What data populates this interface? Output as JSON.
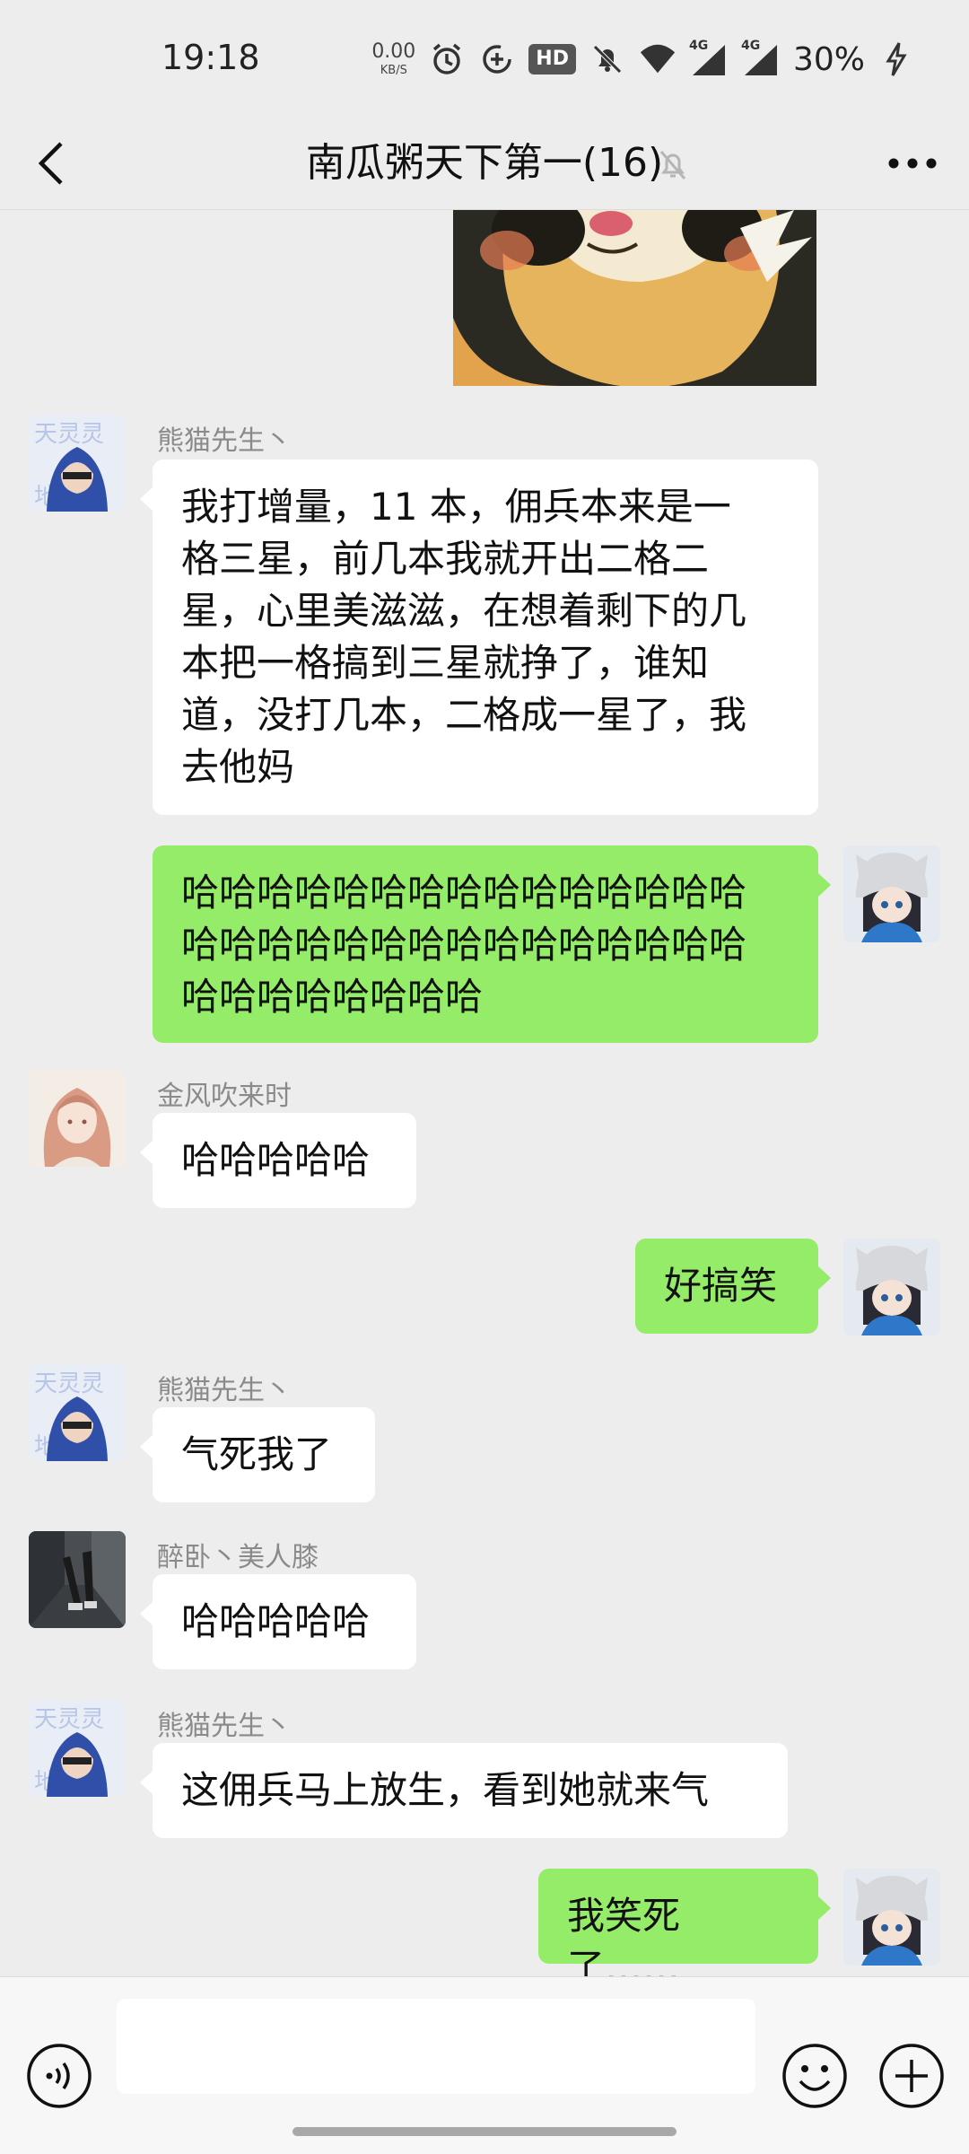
{
  "status_bar": {
    "time": "19:18",
    "net_speed_value": "0.00",
    "net_speed_unit": "KB/S",
    "hd_label": "HD",
    "signal_label_1": "4G",
    "signal_label_2": "4G",
    "battery": "30%"
  },
  "header": {
    "title": "南瓜粥天下第一(16)"
  },
  "messages": [
    {
      "sender": "熊猫先生丶",
      "text": "我打增量，11 本，佣兵本来是一格三星，前几本我就开出二格二星，心里美滋滋，在想着剩下的几本把一格搞到三星就挣了，谁知道，没打几本，二格成一星了，我去他妈",
      "lines": [
        "我打增量，11 本，佣兵本来是一",
        "格三星，前几本我就开出二格二",
        "星，心里美滋滋，在想着剩下的几",
        "本把一格搞到三星就挣了，谁知",
        "道，没打几本，二格成一星了，我",
        "去他妈"
      ]
    },
    {
      "sender": "",
      "text": "哈哈哈哈哈哈哈哈哈哈哈哈哈哈哈哈哈哈哈哈哈哈哈哈哈哈哈哈哈哈哈哈哈哈哈",
      "lines": [
        "哈哈哈哈哈哈哈哈哈哈哈哈哈哈哈",
        "哈哈哈哈哈哈哈哈哈哈哈哈哈哈哈",
        "哈哈哈哈哈哈哈哈"
      ]
    },
    {
      "sender": "金风吹来时",
      "text": "哈哈哈哈哈"
    },
    {
      "sender": "",
      "text": "好搞笑"
    },
    {
      "sender": "熊猫先生丶",
      "text": "气死我了"
    },
    {
      "sender": "醉卧丶美人膝",
      "text": "哈哈哈哈哈"
    },
    {
      "sender": "熊猫先生丶",
      "text": "这佣兵马上放生，看到她就来气"
    },
    {
      "sender": "",
      "text": "我笑死了……"
    }
  ],
  "input": {
    "value": "",
    "placeholder": ""
  },
  "colors": {
    "chat_background": "#ededed",
    "incoming_bubble": "#ffffff",
    "outgoing_bubble": "#95ec69",
    "sender_name": "#8a8a8a"
  },
  "icons": {
    "back": "chevron-left-icon",
    "mute": "bell-off-icon",
    "more": "more-dots-icon",
    "voice": "voice-icon",
    "emoji": "emoji-icon",
    "plus": "plus-icon"
  }
}
